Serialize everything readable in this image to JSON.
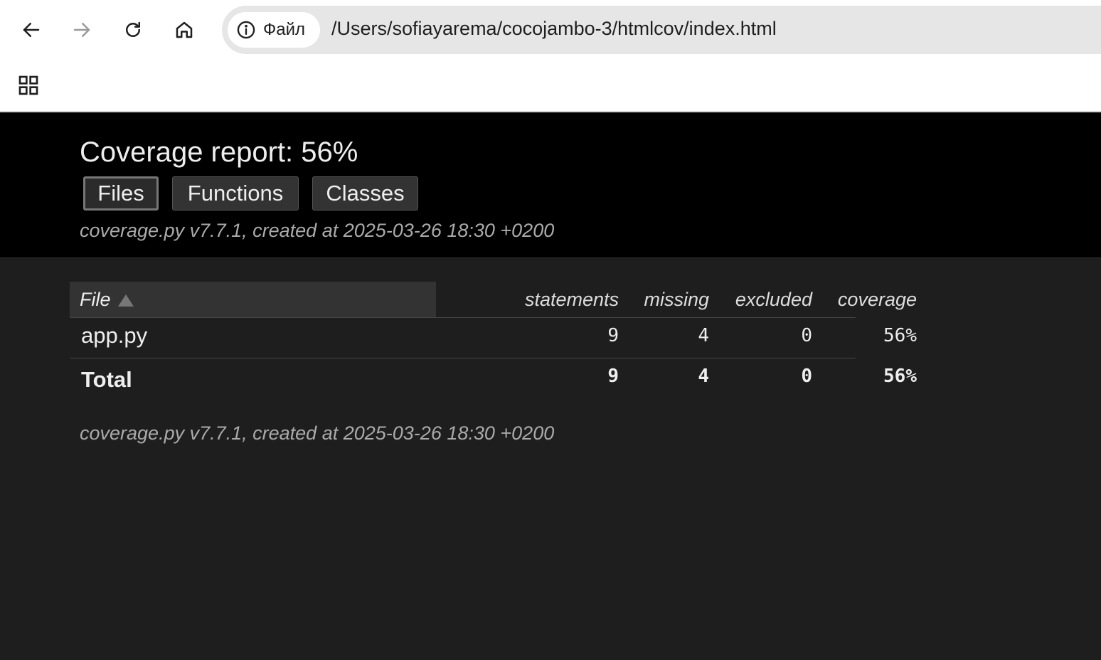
{
  "browser": {
    "site_info_label": "Файл",
    "url": "/Users/sofiayarema/cocojambo-3/htmlcov/index.html",
    "icons": [
      "back-icon",
      "forward-icon",
      "reload-icon",
      "home-icon",
      "info-icon",
      "apps-icon"
    ]
  },
  "header": {
    "title": "Coverage report: 56%",
    "tabs": [
      {
        "label": "Files",
        "current": true
      },
      {
        "label": "Functions",
        "current": false
      },
      {
        "label": "Classes",
        "current": false
      }
    ],
    "meta": "coverage.py v7.7.1, created at 2025-03-26 18:30 +0200"
  },
  "table": {
    "columns": {
      "file": "File",
      "statements": "statements",
      "missing": "missing",
      "excluded": "excluded",
      "coverage": "coverage"
    },
    "rows": [
      {
        "file": "app.py",
        "statements": "9",
        "missing": "4",
        "excluded": "0",
        "coverage": "56%"
      }
    ],
    "total": {
      "file": "Total",
      "statements": "9",
      "missing": "4",
      "excluded": "0",
      "coverage": "56%"
    }
  },
  "footer": {
    "meta": "coverage.py v7.7.1, created at 2025-03-26 18:30 +0200"
  },
  "colors": {
    "header_bg": "#000000",
    "page_bg": "#1e1e1e",
    "chrome_bg": "#ffffff",
    "address_bg": "#e6e6e6"
  }
}
